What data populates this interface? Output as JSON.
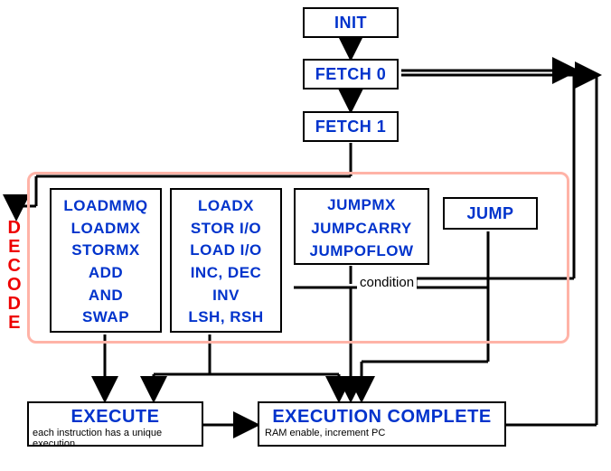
{
  "nodes": {
    "init": "INIT",
    "fetch0": "FETCH 0",
    "fetch1": "FETCH 1",
    "jump": "JUMP",
    "group1": [
      "LOADMMQ",
      "LOADMX",
      "STORMX",
      "ADD",
      "AND",
      "SWAP"
    ],
    "group2": [
      "LOADX",
      "STOR I/O",
      "LOAD I/O",
      "INC, DEC",
      "INV",
      "LSH, RSH"
    ],
    "group3": [
      "JUMPMX",
      "JUMPCARRY",
      "JUMPOFLOW"
    ],
    "condition": "condition",
    "execute_title": "EXECUTE",
    "execute_note": "each instruction has a unique execution",
    "complete_title": "EXECUTION COMPLETE",
    "complete_note": "RAM enable, increment PC"
  },
  "decode_label": [
    "D",
    "E",
    "C",
    "O",
    "D",
    "E"
  ]
}
